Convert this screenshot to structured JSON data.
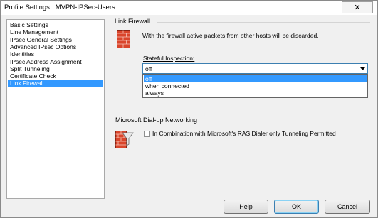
{
  "window": {
    "title": "Profile Settings   MVPN-IPSec-Users",
    "close_glyph": "✕"
  },
  "sidebar": {
    "items": [
      {
        "label": "Basic Settings",
        "selected": false
      },
      {
        "label": "Line Management",
        "selected": false
      },
      {
        "label": "IPsec General Settings",
        "selected": false
      },
      {
        "label": "Advanced IPsec Options",
        "selected": false
      },
      {
        "label": "Identities",
        "selected": false
      },
      {
        "label": "IPsec Address Assignment",
        "selected": false
      },
      {
        "label": "Split Tunneling",
        "selected": false
      },
      {
        "label": "Certificate Check",
        "selected": false
      },
      {
        "label": "Link Firewall",
        "selected": true
      }
    ]
  },
  "firewall_section": {
    "title": "Link Firewall",
    "icon": "firewall-icon",
    "description": "With the firewall active packets from other hosts will be discarded.",
    "stateful_label": "Stateful Inspection:",
    "stateful_value": "off",
    "options": [
      {
        "label": "off",
        "selected": true
      },
      {
        "label": "when connected",
        "selected": false
      },
      {
        "label": "always",
        "selected": false
      }
    ]
  },
  "dialup_section": {
    "title": "Microsoft Dial-up Networking",
    "icon": "firewall-filter-icon",
    "checkbox_label": "In Combination with Microsoft's RAS Dialer only Tunneling Permitted",
    "checked": false
  },
  "footer": {
    "help_label": "Help",
    "ok_label": "OK",
    "cancel_label": "Cancel"
  },
  "colors": {
    "selection": "#3399ff",
    "firewall_red": "#d9452b"
  }
}
